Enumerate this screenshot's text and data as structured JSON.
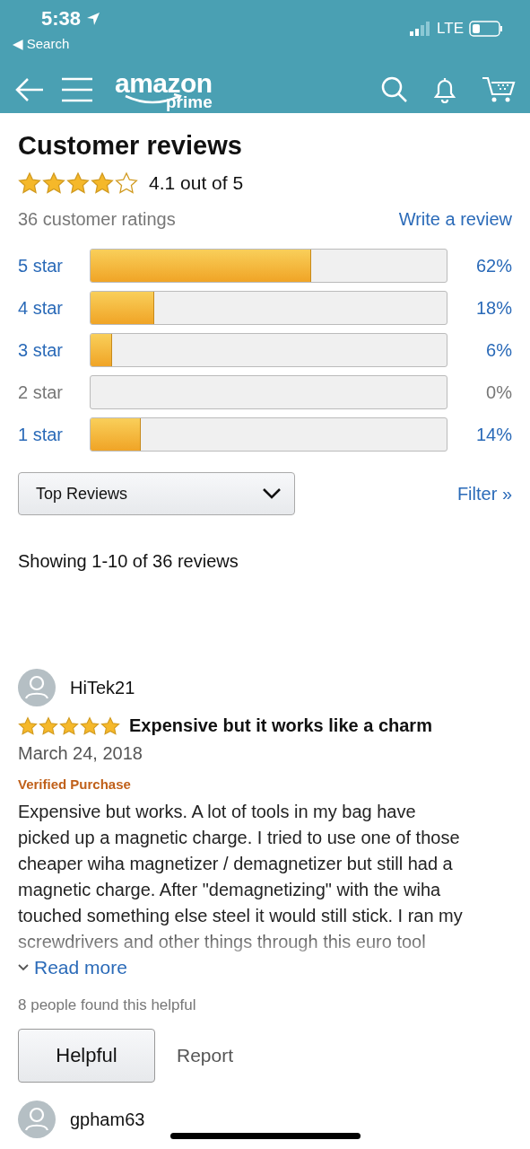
{
  "status_bar": {
    "time": "5:38",
    "back_label": "◀ Search",
    "network": "LTE"
  },
  "nav": {
    "logo_word": "amazon",
    "logo_sub": "prime"
  },
  "summary": {
    "title": "Customer reviews",
    "stars": 4,
    "rating_text": "4.1 out of 5",
    "ratings_count": "36 customer ratings",
    "write_link": "Write a review"
  },
  "histogram": [
    {
      "label": "5 star",
      "level": 0.62,
      "percent": "62%",
      "disabled": false
    },
    {
      "label": "4 star",
      "level": 0.18,
      "percent": "18%",
      "disabled": false
    },
    {
      "label": "3 star",
      "level": 0.06,
      "percent": "6%",
      "disabled": false
    },
    {
      "label": "2 star",
      "level": 0,
      "percent": "0%",
      "disabled": true
    },
    {
      "label": "1 star",
      "level": 0.14,
      "percent": "14%",
      "disabled": false
    }
  ],
  "sort": {
    "value": "Top Reviews",
    "filter": "Filter »"
  },
  "showing": "Showing 1-10 of 36 reviews",
  "reviews": [
    {
      "author": "HiTek21",
      "stars": 5,
      "title": "Expensive but it works like a charm",
      "date": "March 24, 2018",
      "badge": "Verified Purchase",
      "body_lines": [
        "Expensive but works. A lot of tools in my bag have",
        "picked up a magnetic charge. I tried to use one of those",
        "cheaper wiha magnetizer / demagnetizer but still had a",
        "magnetic charge. After \"demagnetizing\" with the wiha",
        "touched something else steel it would still stick. I ran my",
        "screwdrivers and other things through this euro tool"
      ],
      "read_more": "Read more",
      "helpful_count": "8 people found this helpful",
      "helpful_button": "Helpful",
      "report": "Report"
    },
    {
      "author": "gpham63"
    }
  ]
}
